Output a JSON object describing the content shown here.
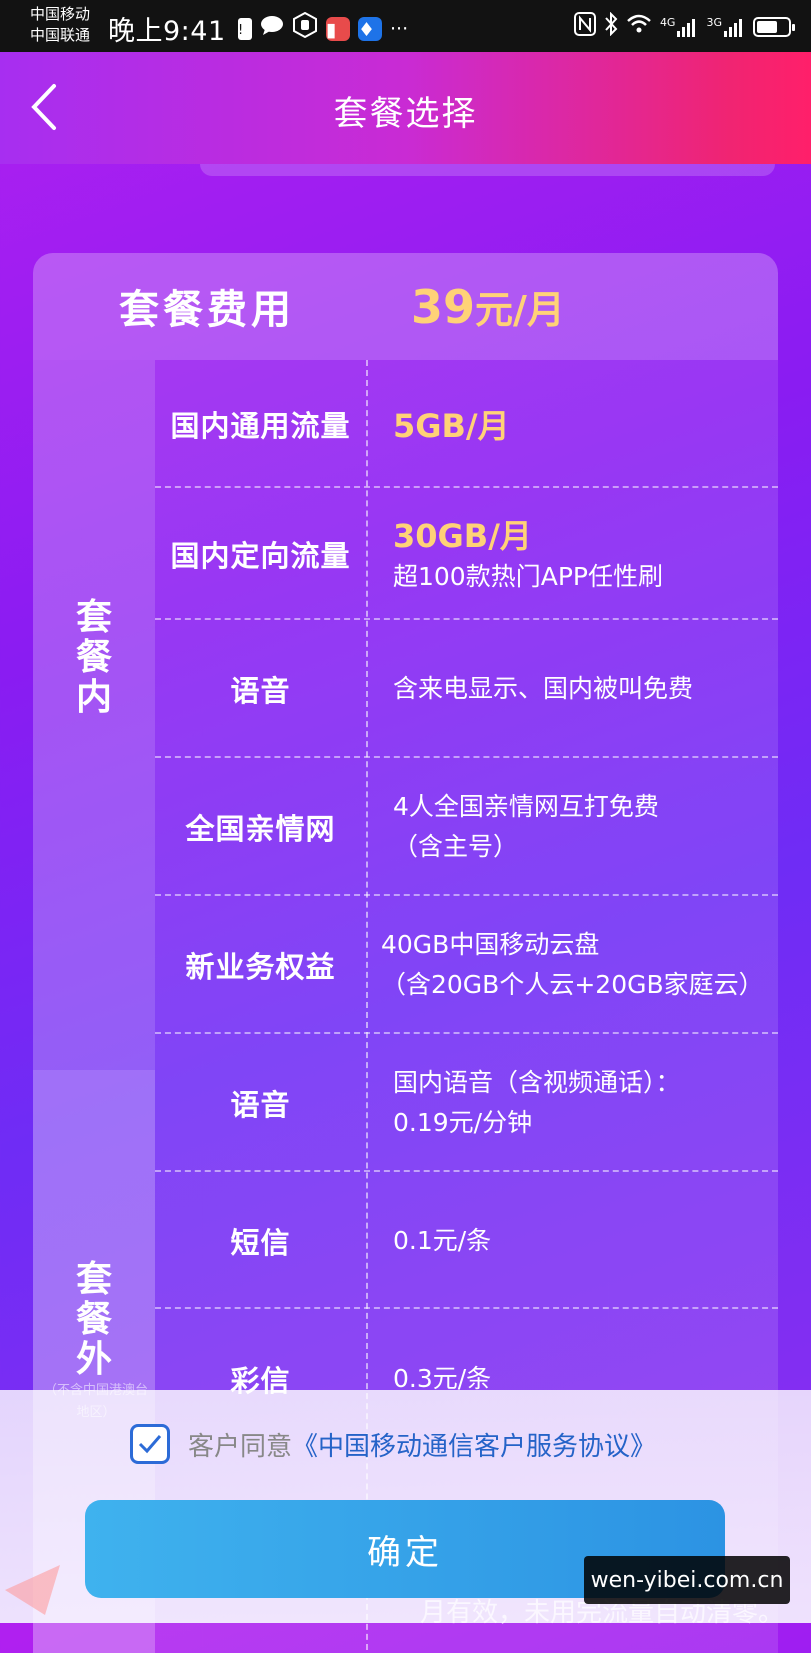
{
  "status_bar": {
    "carrier_1": "中国移动",
    "carrier_2": "中国联通",
    "time": "晚上9:41",
    "more": "···",
    "signal_1": "4G",
    "signal_2": "3G"
  },
  "header": {
    "title": "套餐选择"
  },
  "plan": {
    "fee_label": "套餐费用",
    "fee_amount": "39",
    "fee_unit": "元/月",
    "section_included": "套餐内",
    "section_excluded": "套餐外",
    "excluded_note": "（不含中国港澳台地区）",
    "rows": [
      {
        "label": "国内通用流量",
        "value": "5GB/月",
        "sub": ""
      },
      {
        "label": "国内定向流量",
        "value": "30GB/月",
        "sub": "超100款热门APP任性刷"
      },
      {
        "label": "语音",
        "value": "",
        "sub": "含来电显示、国内被叫免费"
      },
      {
        "label": "全国亲情网",
        "value": "",
        "sub": "4人全国亲情网互打免费",
        "sub2": "（含主号）"
      },
      {
        "label": "新业务权益",
        "value": "",
        "sub": "40GB中国移动云盘",
        "sub2": "（含20GB个人云+20GB家庭云）"
      },
      {
        "label": "语音",
        "value": "",
        "sub": "国内语音（含视频通话）：",
        "sub2": "0.19元/分钟"
      },
      {
        "label": "短信",
        "value": "",
        "sub": "0.1元/条"
      },
      {
        "label": "彩信",
        "value": "",
        "sub": "0.3元/条"
      }
    ]
  },
  "agreement": {
    "prefix": "客户同意",
    "link": "《中国移动通信客户服务协议》",
    "checked": true
  },
  "confirm_label": "确定",
  "peek_text": "月有效，未用完流量自动清零。",
  "watermark": "wen-yibei.com.cn",
  "colors": {
    "accent_gold": "#ffd277",
    "button_blue": "#3fb2ee",
    "link_blue": "#2563c8"
  }
}
